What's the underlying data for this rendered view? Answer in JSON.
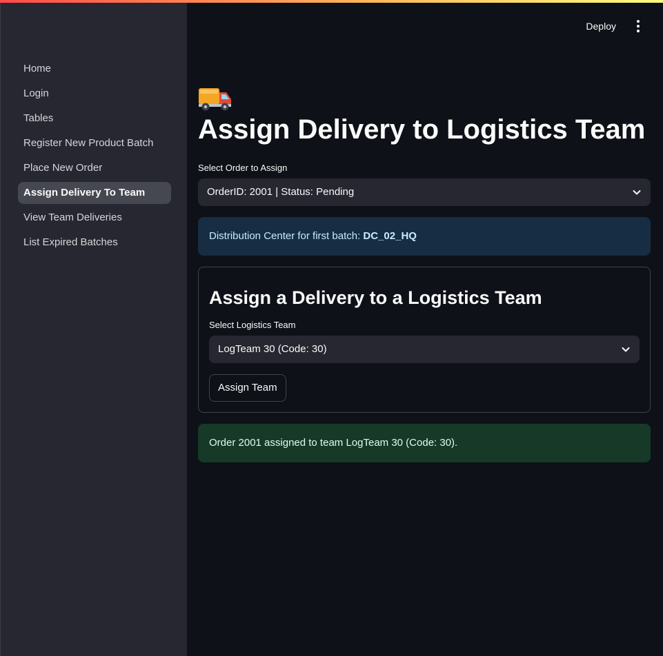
{
  "app": {
    "deploy_label": "Deploy",
    "menu_icon": "kebab-menu-icon"
  },
  "sidebar": {
    "items": [
      {
        "label": "Home",
        "active": false
      },
      {
        "label": "Login",
        "active": false
      },
      {
        "label": "Tables",
        "active": false
      },
      {
        "label": "Register New Product Batch",
        "active": false
      },
      {
        "label": "Place New Order",
        "active": false
      },
      {
        "label": "Assign Delivery To Team",
        "active": true
      },
      {
        "label": "View Team Deliveries",
        "active": false
      },
      {
        "label": "List Expired Batches",
        "active": false
      }
    ]
  },
  "page": {
    "title_icon": "delivery-truck-icon",
    "title": "Assign Delivery to Logistics Team",
    "order_select": {
      "label": "Select Order to Assign",
      "value": "OrderID: 2001 | Status: Pending"
    },
    "info": {
      "text": "Distribution Center for first batch: ",
      "value": "DC_02_HQ"
    },
    "form": {
      "title": "Assign a Delivery to a Logistics Team",
      "team_select": {
        "label": "Select Logistics Team",
        "value": "LogTeam 30 (Code: 30)"
      },
      "submit_label": "Assign Team"
    },
    "success": {
      "text": "Order 2001 assigned to team LogTeam 30 (Code: 30)."
    }
  },
  "colors": {
    "background": "#0e1117",
    "sidebar": "#262730",
    "info_bg": "#172d43",
    "success_bg": "#173928"
  }
}
